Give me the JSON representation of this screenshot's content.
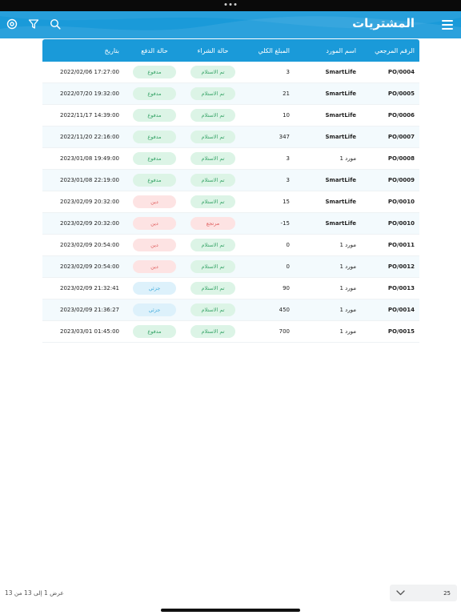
{
  "header": {
    "title": "المشتريات",
    "icons": [
      "menu-icon",
      "search-icon",
      "filter-icon",
      "view-icon"
    ]
  },
  "colors": {
    "primary": "#1a9ad9",
    "status_green": "#3aa66a",
    "status_red": "#e06060",
    "status_blue": "#4bb0de"
  },
  "table": {
    "columns": {
      "ref": "الرقم المرجعي",
      "supplier": "اسم المورد",
      "total": "المبلغ الكلي",
      "purchase_status": "حالة الشراء",
      "payment_status": "حالة الدفع",
      "date": "بتاريخ"
    },
    "rows": [
      {
        "ref": "PO/0004",
        "supplier": "SmartLife",
        "total": "3",
        "purchase_status": "تم الاستلام",
        "payment_status": "مدفوع",
        "date": "2022/02/06 17:27:00"
      },
      {
        "ref": "PO/0005",
        "supplier": "SmartLife",
        "total": "21",
        "purchase_status": "تم الاستلام",
        "payment_status": "مدفوع",
        "date": "2022/07/20 19:32:00"
      },
      {
        "ref": "PO/0006",
        "supplier": "SmartLife",
        "total": "10",
        "purchase_status": "تم الاستلام",
        "payment_status": "مدفوع",
        "date": "2022/11/17 14:39:00"
      },
      {
        "ref": "PO/0007",
        "supplier": "SmartLife",
        "total": "347",
        "purchase_status": "تم الاستلام",
        "payment_status": "مدفوع",
        "date": "2022/11/20 22:16:00"
      },
      {
        "ref": "PO/0008",
        "supplier": "مورد 1",
        "total": "3",
        "purchase_status": "تم الاستلام",
        "payment_status": "مدفوع",
        "date": "2023/01/08 19:49:00"
      },
      {
        "ref": "PO/0009",
        "supplier": "SmartLife",
        "total": "3",
        "purchase_status": "تم الاستلام",
        "payment_status": "مدفوع",
        "date": "2023/01/08 22:19:00"
      },
      {
        "ref": "PO/0010",
        "supplier": "SmartLife",
        "total": "15",
        "purchase_status": "تم الاستلام",
        "payment_status": "دين",
        "date": "2023/02/09 20:32:00"
      },
      {
        "ref": "PO/0010",
        "supplier": "SmartLife",
        "total": "15-",
        "purchase_status": "مرتجع",
        "payment_status": "دين",
        "date": "2023/02/09 20:32:00"
      },
      {
        "ref": "PO/0011",
        "supplier": "مورد 1",
        "total": "0",
        "purchase_status": "تم الاستلام",
        "payment_status": "دين",
        "date": "2023/02/09 20:54:00"
      },
      {
        "ref": "PO/0012",
        "supplier": "مورد 1",
        "total": "0",
        "purchase_status": "تم الاستلام",
        "payment_status": "دين",
        "date": "2023/02/09 20:54:00"
      },
      {
        "ref": "PO/0013",
        "supplier": "مورد 1",
        "total": "90",
        "purchase_status": "تم الاستلام",
        "payment_status": "جزئي",
        "date": "2023/02/09 21:32:41"
      },
      {
        "ref": "PO/0014",
        "supplier": "مورد 1",
        "total": "450",
        "purchase_status": "تم الاستلام",
        "payment_status": "جزئي",
        "date": "2023/02/09 21:36:27"
      },
      {
        "ref": "PO/0015",
        "supplier": "مورد 1",
        "total": "700",
        "purchase_status": "تم الاستلام",
        "payment_status": "مدفوع",
        "date": "2023/03/01 01:45:00"
      }
    ]
  },
  "footer": {
    "count_text": "عرض 1 إلى 13 من 13",
    "page_size": "25"
  }
}
